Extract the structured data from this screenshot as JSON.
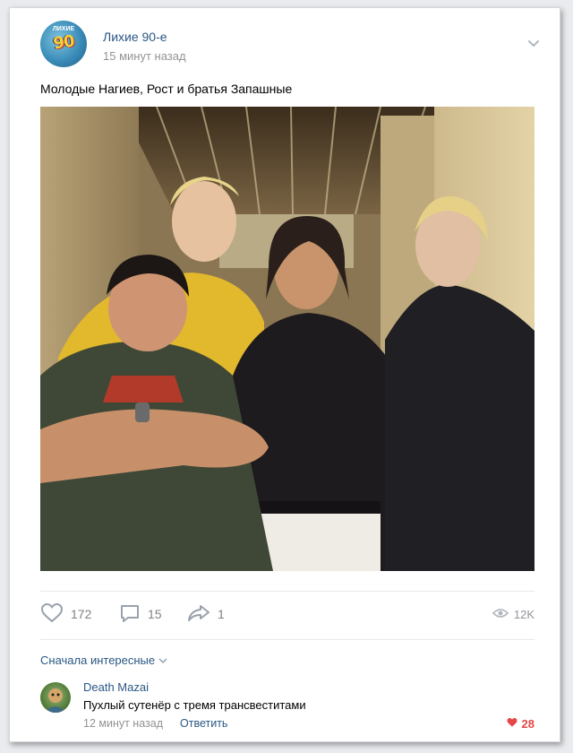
{
  "post": {
    "group_name": "Лихие 90-е",
    "time": "15 минут назад",
    "text": "Молодые Нагиев, Рост и братья Запашные",
    "avatar_logo_text": "90",
    "avatar_logo_top": "ЛИХИЕ"
  },
  "actions": {
    "likes": "172",
    "comments": "15",
    "shares": "1",
    "views": "12K"
  },
  "comments_section": {
    "sort_label": "Сначала интересные"
  },
  "comment": {
    "author": "Death Mazai",
    "text": "Пухлый сутенёр с тремя трансвеститами",
    "time": "12 минут назад",
    "reply_label": "Ответить",
    "likes": "28"
  },
  "colors": {
    "link": "#2a5885",
    "muted": "#939393",
    "like_active": "#e64646"
  }
}
